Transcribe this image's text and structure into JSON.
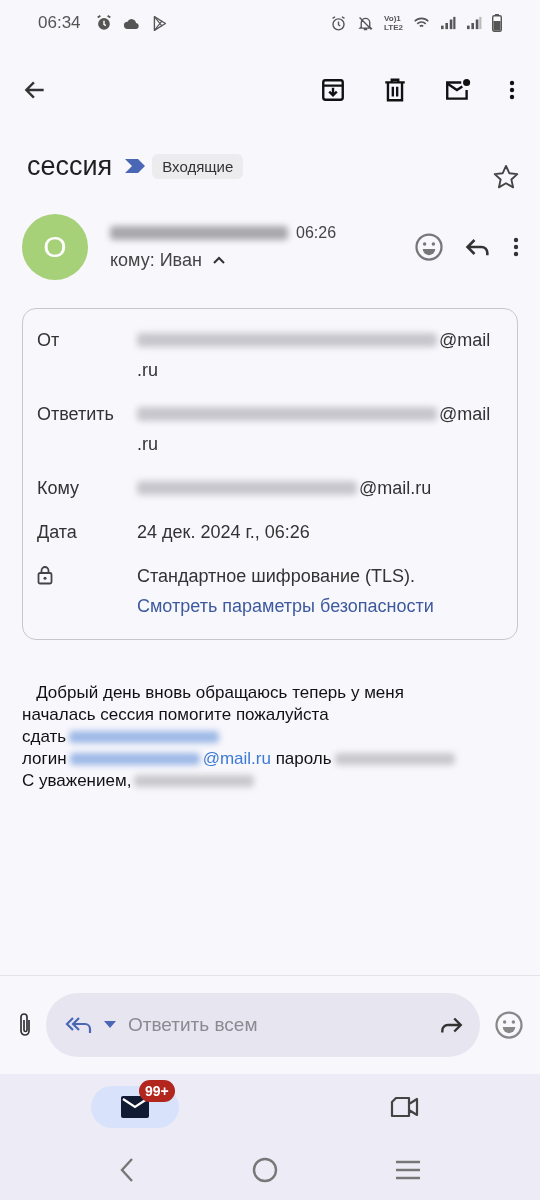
{
  "status_bar": {
    "time": "06:34",
    "network_top": "Vo)1",
    "network_bottom": "LTE2"
  },
  "subject": {
    "title": "сессия",
    "label": "Входящие",
    "starred": false
  },
  "message": {
    "avatar_letter": "O",
    "time": "06:26",
    "recipient": "кому: Иван",
    "details_expanded": true
  },
  "details": [
    {
      "kind": "address",
      "label": "От",
      "value_lines": [
        "@mail",
        ".ru"
      ]
    },
    {
      "kind": "address",
      "label": "Ответить",
      "value_lines": [
        "@mail",
        ".ru"
      ]
    },
    {
      "kind": "address",
      "label": "Кому",
      "value_lines": [
        "@mail.ru"
      ]
    },
    {
      "kind": "text",
      "label": "Дата",
      "value_lines": [
        "24 дек. 2024 г., 06:26"
      ]
    },
    {
      "kind": "security",
      "value_lines": [
        "Стандартное шифрование (TLS)."
      ],
      "link": "Смотреть параметры безопасности"
    }
  ],
  "body": [
    [
      {
        "kind": "text",
        "text": "   Добрый день вновь обращаюсь теперь у меня"
      }
    ],
    [
      {
        "kind": "text",
        "text": "началась сессия помогите пожалуйста"
      }
    ],
    [
      {
        "kind": "text",
        "text": "сдать"
      },
      {
        "kind": "blurred_link"
      }
    ],
    [
      {
        "kind": "text",
        "text": "логин"
      },
      {
        "kind": "blurred_link"
      },
      {
        "kind": "link",
        "text": "@mail.ru"
      },
      {
        "kind": "text",
        "text": " пароль"
      },
      {
        "kind": "blurred_text"
      }
    ],
    [
      {
        "kind": "text",
        "text": "С уважением,"
      },
      {
        "kind": "blurred_text"
      }
    ]
  ],
  "reply_bar": {
    "placeholder": "Ответить всем"
  },
  "bottom_nav": [
    {
      "kind": "mail",
      "selected": true,
      "badge": "99+"
    },
    {
      "kind": "video",
      "selected": false
    }
  ]
}
